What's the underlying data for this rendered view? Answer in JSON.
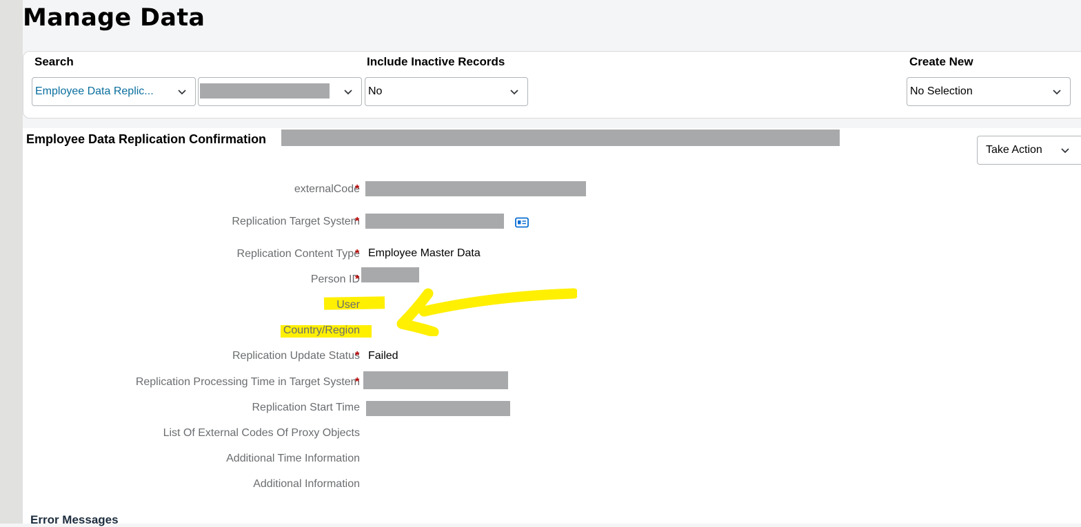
{
  "page": {
    "title": "Manage Data"
  },
  "search_panel": {
    "search_label": "Search",
    "search_type_value": "Employee Data Replic...",
    "inactive_label": "Include Inactive Records",
    "inactive_value": "No",
    "create_label": "Create New",
    "create_value": "No Selection"
  },
  "record": {
    "title": "Employee Data Replication Confirmation",
    "take_action_label": "Take Action",
    "fields": [
      {
        "label": "externalCode",
        "value": ""
      },
      {
        "label": "Replication Target System",
        "value": ""
      },
      {
        "label": "Replication Content Type",
        "value": "Employee Master Data"
      },
      {
        "label": "Person ID",
        "value": ""
      },
      {
        "label": "User",
        "value": ""
      },
      {
        "label": "Country/Region",
        "value": ""
      },
      {
        "label": "Replication Update Status",
        "value": "Failed"
      },
      {
        "label": "Replication Processing Time in Target System",
        "value": ""
      },
      {
        "label": "Replication Start Time",
        "value": ""
      },
      {
        "label": "List Of External Codes Of Proxy Objects",
        "value": ""
      },
      {
        "label": "Additional Time Information",
        "value": ""
      },
      {
        "label": "Additional Information",
        "value": ""
      }
    ],
    "required_mark": "*"
  },
  "errors": {
    "title": "Error Messages"
  },
  "colors": {
    "highlight": "#ffef00",
    "link": "#0a6ed1",
    "required": "#bb0000",
    "redaction": "#a8a9ab"
  }
}
